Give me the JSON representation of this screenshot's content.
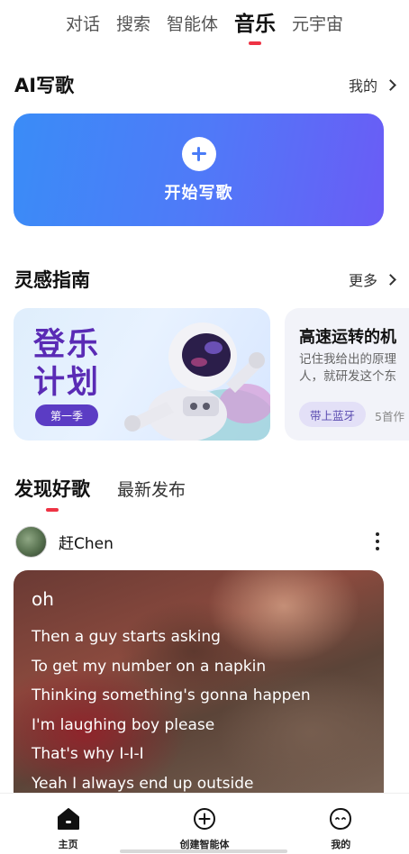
{
  "top_tabs": [
    {
      "label": "对话"
    },
    {
      "label": "搜索"
    },
    {
      "label": "智能体"
    },
    {
      "label": "音乐",
      "active": true
    },
    {
      "label": "元宇宙"
    }
  ],
  "ai_write": {
    "title": "AI写歌",
    "link": "我的",
    "banner_label": "开始写歌"
  },
  "inspiration": {
    "title": "灵感指南",
    "link": "更多",
    "card1": {
      "line1": "登乐",
      "line2": "计划",
      "pill": "第一季"
    },
    "card2": {
      "title": "高速运转的机",
      "desc_line1": "记住我给出的原理",
      "desc_line2": "人，就研发这个东",
      "tag": "带上蓝牙",
      "count": "5首作"
    }
  },
  "discover": {
    "tabs": [
      {
        "label": "发现好歌",
        "active": true
      },
      {
        "label": "最新发布"
      }
    ],
    "post": {
      "user_name": "赶Chen",
      "lyric_title": "oh",
      "lyrics": [
        "Then a guy starts asking",
        "To get my number on a napkin",
        "Thinking something's gonna happen",
        "I'm laughing boy please",
        "That's why I-I-I",
        "Yeah I always end up outside"
      ]
    }
  },
  "bottom_nav": [
    {
      "label": "主页",
      "icon": "home-icon",
      "active": true
    },
    {
      "label": "创建智能体",
      "icon": "plus-circle-icon"
    },
    {
      "label": "我的",
      "icon": "face-icon"
    }
  ],
  "colors": {
    "accent_red": "#ee3344",
    "banner_start": "#3a8cf7",
    "banner_end": "#6a5cf6",
    "purple": "#5b3cc4"
  }
}
